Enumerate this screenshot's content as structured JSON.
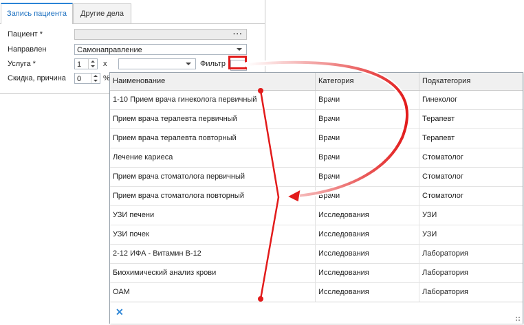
{
  "tabs": [
    {
      "label": "Запись пациента",
      "active": true
    },
    {
      "label": "Другие дела",
      "active": false
    }
  ],
  "form": {
    "patient_label": "Пациент *",
    "patient_value": "",
    "direction_label": "Направлен",
    "direction_value": "Самонаправление",
    "service_label": "Услуга *",
    "service_qty": "1",
    "service_mult": "x",
    "filter_label": "Фильтр",
    "discount_label": "Скидка, причина",
    "discount_value": "0",
    "percent": "%"
  },
  "grid": {
    "columns": [
      "Наименование",
      "Категория",
      "Подкатегория"
    ],
    "rows": [
      [
        "1-10 Прием врача гинеколога первичный",
        "Врачи",
        "Гинеколог"
      ],
      [
        "Прием врача терапевта первичный",
        "Врачи",
        "Терапевт"
      ],
      [
        "Прием врача терапевта повторный",
        "Врачи",
        "Терапевт"
      ],
      [
        "Лечение кариеса",
        "Врачи",
        "Стоматолог"
      ],
      [
        "Прием врача стоматолога первичный",
        "Врачи",
        "Стоматолог"
      ],
      [
        "Прием врача стоматолога повторный",
        "Врачи",
        "Стоматолог"
      ],
      [
        "УЗИ печени",
        "Исследования",
        "УЗИ"
      ],
      [
        "УЗИ почек",
        "Исследования",
        "УЗИ"
      ],
      [
        "2-12 ИФА - Витамин В-12",
        "Исследования",
        "Лаборатория"
      ],
      [
        "Биохимический анализ крови",
        "Исследования",
        "Лаборатория"
      ],
      [
        "ОАМ",
        "Исследования",
        "Лаборатория"
      ]
    ],
    "close_icon": "close-icon"
  },
  "colors": {
    "accent": "#2b84d6",
    "annotation": "#e21b1b"
  }
}
